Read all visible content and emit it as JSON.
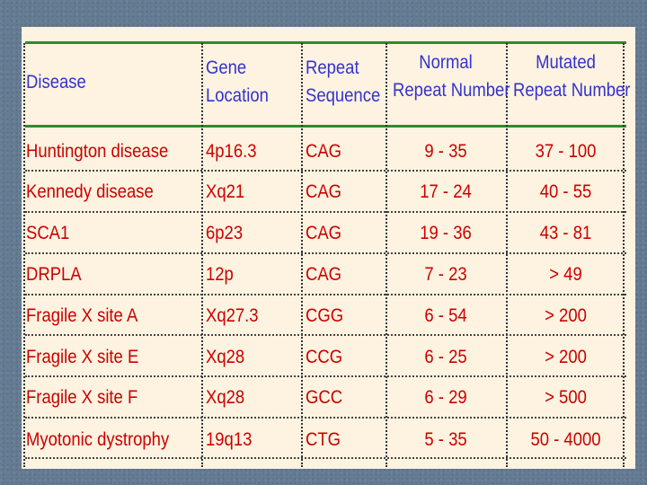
{
  "table": {
    "headers": [
      {
        "line1": "Disease",
        "line2": ""
      },
      {
        "line1": "Gene",
        "line2": "Location"
      },
      {
        "line1": "Repeat",
        "line2": "Sequence"
      },
      {
        "line1": "Normal",
        "line2": "Repeat Number"
      },
      {
        "line1": "Mutated",
        "line2": "Repeat Number"
      }
    ],
    "rows": [
      [
        "Huntington disease",
        "4p16.3",
        "CAG",
        "9 - 35",
        "37 - 100"
      ],
      [
        "Kennedy disease",
        "Xq21",
        "CAG",
        "17 - 24",
        "40 - 55"
      ],
      [
        "SCA1",
        "6p23",
        "CAG",
        "19 - 36",
        "43 - 81"
      ],
      [
        "DRPLA",
        "12p",
        "CAG",
        "7 - 23",
        "> 49"
      ],
      [
        "Fragile X site A",
        "Xq27.3",
        "CGG",
        "6 - 54",
        "> 200"
      ],
      [
        "Fragile X site E",
        "Xq28",
        "CCG",
        "6 - 25",
        "> 200"
      ],
      [
        "Fragile X site F",
        "Xq28",
        "GCC",
        "6 - 29",
        "> 500"
      ],
      [
        "Myotonic dystrophy",
        "19q13",
        "CTG",
        "5 - 35",
        "50 - 4000"
      ]
    ]
  },
  "colors": {
    "header_text": "#3333cc",
    "body_text": "#cc0000",
    "rule": "#2f8a2f",
    "background": "#fdf3e0"
  }
}
